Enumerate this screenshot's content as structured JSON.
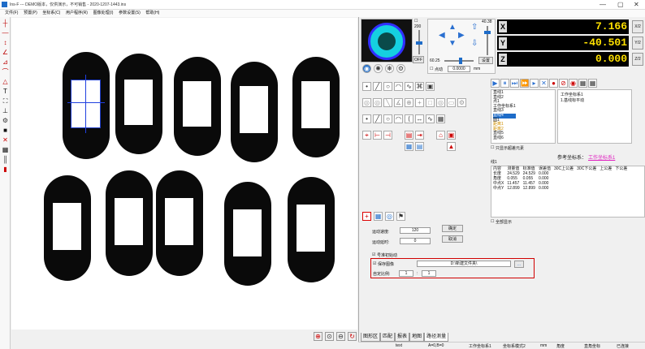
{
  "window": {
    "title": "Ins-F --- DEMO版本，仅供演示，不可销售 - 2020-1207-1443.ins",
    "controls": [
      "—",
      "▢",
      "✕"
    ]
  },
  "menu": [
    "文件(F)",
    "预置(P)",
    "坐标系(C)",
    "用户程序(R)",
    "图像处理(I)",
    "参数设置(S)",
    "帮助(H)"
  ],
  "camera": {
    "slider_top_value": "200",
    "off_label": "OFF",
    "motion_top_value": "40.38",
    "motion_left_value": "60.25",
    "set_label": "设置",
    "point_label": "点动",
    "step_value": "0.0000",
    "unit": "mm"
  },
  "dro": [
    {
      "axis": "X",
      "value": "7.166",
      "half": "X/2"
    },
    {
      "axis": "Y",
      "value": "-40.501",
      "half": "Y/2"
    },
    {
      "axis": "Z",
      "value": "0.000",
      "half": "Z/2"
    }
  ],
  "tree": {
    "items": [
      "直线1",
      "直线2",
      "点1",
      "工作坐标系1",
      "直线3",
      "直线4",
      "圆1",
      "距离1",
      "距离2",
      "直线5",
      "直线6"
    ],
    "show_sketch_label": "只显示超差元素"
  },
  "coords_panel": {
    "items": [
      "工作坐标系1",
      "1.基线标平动"
    ]
  },
  "reference": {
    "label": "参考坐标系：",
    "value": "工作坐标系1"
  },
  "results": {
    "element": "线1",
    "headers": [
      "内容",
      "测量值",
      "标准值",
      "误差值",
      "30C上公差",
      "30C下公差",
      "上公差",
      "下公差"
    ],
    "rows": [
      [
        "长度",
        "24.529",
        "24.529",
        "0.000"
      ],
      [
        "角度",
        "0.055",
        "0.055",
        "0.000"
      ],
      [
        "中点X",
        "11.457",
        "11.457",
        "0.000"
      ],
      [
        "中点Y",
        "12.899",
        "12.899",
        "0.000"
      ]
    ],
    "show_all_label": "全部显示"
  },
  "motion_form": {
    "speed_label": "运动速度:",
    "speed_value": "120",
    "delay_label": "运动延时:",
    "delay_value": "0",
    "ok_label": "确定",
    "cancel_label": "取消",
    "auto_label": "号准初始动",
    "save_image_label": "保存图像",
    "save_path": "D:\\新建文件夹\\",
    "browse_label": "...",
    "scale_label": "自定比例:",
    "scale_a": "1",
    "scale_sep": ":",
    "scale_b": "1"
  },
  "tabs": [
    "图形区",
    "匹配",
    "报表",
    "地图",
    "路径测量"
  ],
  "status": {
    "font": "text",
    "coord": "A=0,B=0",
    "work": "工作坐标系1",
    "mode": "坐标系模式2",
    "unit": "mm",
    "angle": "角度",
    "angle_type": "直角坐标",
    "state": "已连接"
  },
  "colors": {
    "accent": "#0077cc",
    "highlight_red": "#d00000",
    "dro_value": "#ffe100",
    "selection": "#1e6cc8"
  }
}
